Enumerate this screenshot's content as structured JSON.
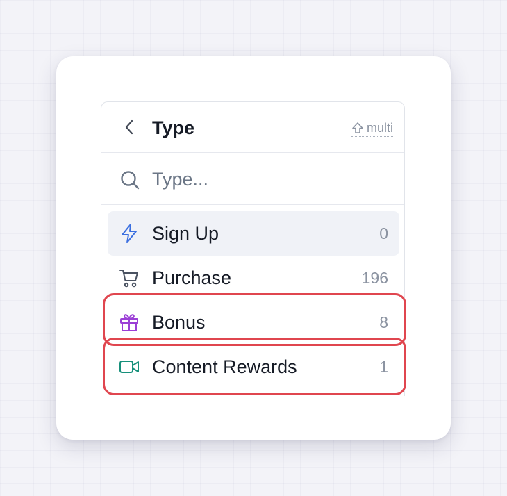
{
  "header": {
    "title": "Type",
    "multi_label": "multi"
  },
  "search": {
    "placeholder": "Type..."
  },
  "items": [
    {
      "label": "Sign Up",
      "count": "0",
      "icon": "lightning-icon",
      "highlighted": true
    },
    {
      "label": "Purchase",
      "count": "196",
      "icon": "cart-icon"
    },
    {
      "label": "Bonus",
      "count": "8",
      "icon": "gift-icon"
    },
    {
      "label": "Content Rewards",
      "count": "1",
      "icon": "video-camera-icon"
    }
  ],
  "colors": {
    "lightning": "#3b6fe0",
    "gift": "#9b3fd6",
    "video": "#17907b",
    "annotation": "#e0464f"
  }
}
